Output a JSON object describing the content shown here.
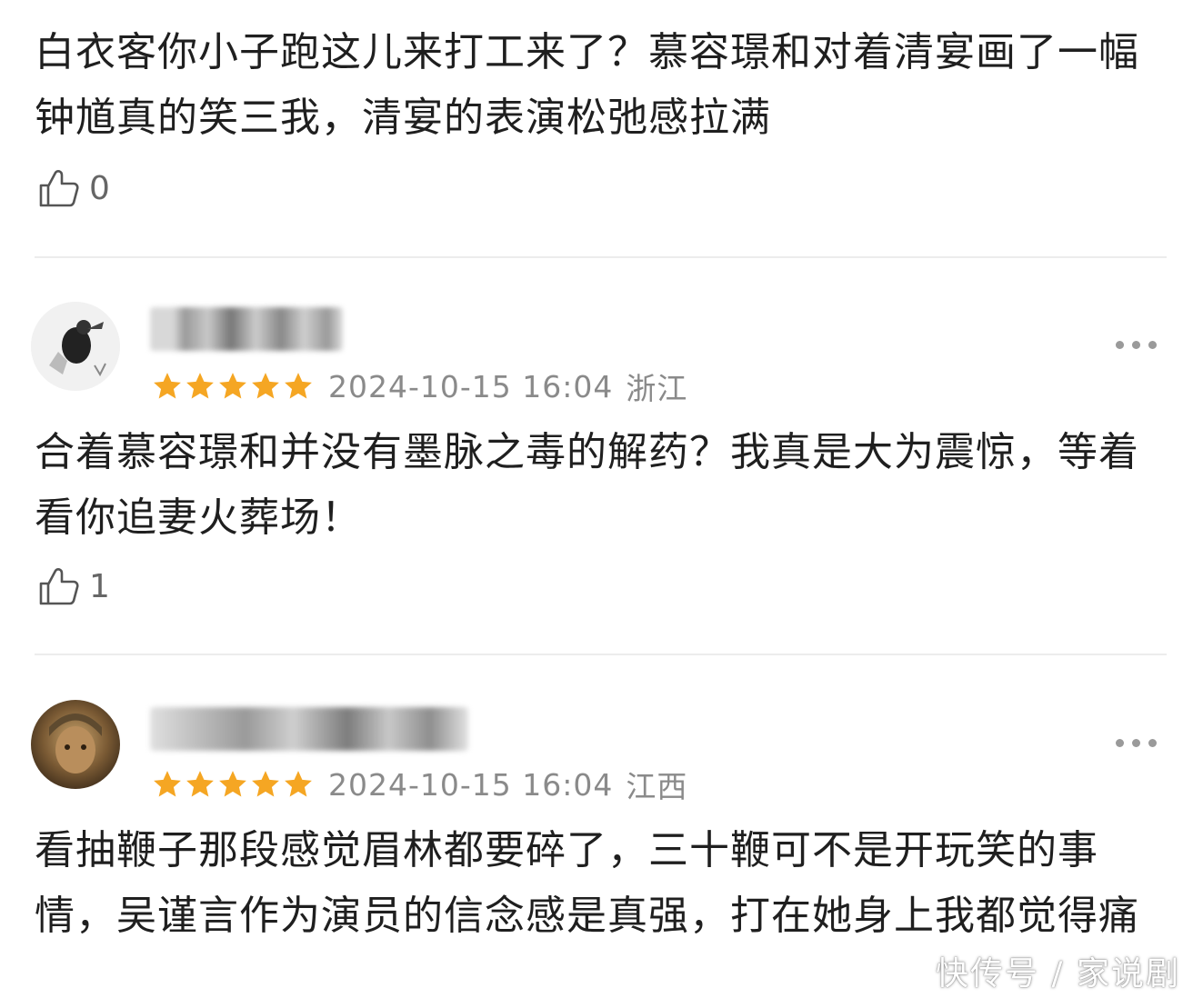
{
  "comments": [
    {
      "text": "白衣客你小子跑这儿来打工来了？慕容璟和对着清宴画了一幅钟馗真的笑三我，清宴的表演松弛感拉满",
      "likes": "0"
    },
    {
      "date": "2024-10-15 16:04",
      "location": "浙江",
      "stars": 5,
      "text": "合着慕容璟和并没有墨脉之毒的解药？我真是大为震惊，等着看你追妻火葬场！",
      "likes": "1"
    },
    {
      "date": "2024-10-15 16:04",
      "location": "江西",
      "stars": 5,
      "text": "看抽鞭子那段感觉眉林都要碎了，三十鞭可不是开玩笑的事情，吴谨言作为演员的信念感是真强，打在她身上我都觉得痛"
    }
  ],
  "icons": {
    "like": "thumbs-up-icon",
    "star": "star-icon",
    "more": "more-dots-icon"
  },
  "colors": {
    "star": "#f5a623",
    "meta_text": "#8a8a8a",
    "divider": "#ececec"
  },
  "watermark": "快传号 / 家说剧"
}
